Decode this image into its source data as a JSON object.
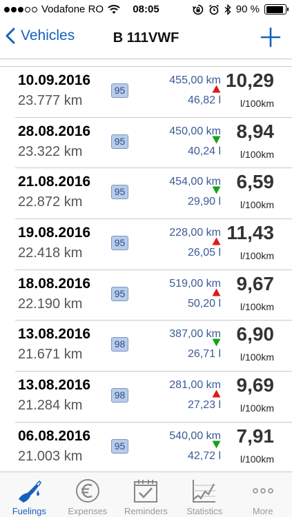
{
  "status_bar": {
    "carrier": "Vodafone RO",
    "time": "08:05",
    "battery": "90 %",
    "battery_level": 0.9,
    "signal_bars": 3
  },
  "nav": {
    "back_label": "Vehicles",
    "title": "B 111VWF"
  },
  "entries": [
    {
      "date": "10.09.2016",
      "odometer": "23.777 km",
      "fuel": "95",
      "distance": "455,00 km",
      "volume": "46,82 l",
      "trend": "up",
      "consumption": "10,29",
      "unit": "l/100km"
    },
    {
      "date": "28.08.2016",
      "odometer": "23.322 km",
      "fuel": "95",
      "distance": "450,00 km",
      "volume": "40,24 l",
      "trend": "down",
      "consumption": "8,94",
      "unit": "l/100km"
    },
    {
      "date": "21.08.2016",
      "odometer": "22.872 km",
      "fuel": "95",
      "distance": "454,00 km",
      "volume": "29,90 l",
      "trend": "down",
      "consumption": "6,59",
      "unit": "l/100km"
    },
    {
      "date": "19.08.2016",
      "odometer": "22.418 km",
      "fuel": "95",
      "distance": "228,00 km",
      "volume": "26,05 l",
      "trend": "up",
      "consumption": "11,43",
      "unit": "l/100km"
    },
    {
      "date": "18.08.2016",
      "odometer": "22.190 km",
      "fuel": "95",
      "distance": "519,00 km",
      "volume": "50,20 l",
      "trend": "up",
      "consumption": "9,67",
      "unit": "l/100km"
    },
    {
      "date": "13.08.2016",
      "odometer": "21.671 km",
      "fuel": "98",
      "distance": "387,00 km",
      "volume": "26,71 l",
      "trend": "down",
      "consumption": "6,90",
      "unit": "l/100km"
    },
    {
      "date": "13.08.2016",
      "odometer": "21.284 km",
      "fuel": "98",
      "distance": "281,00 km",
      "volume": "27,23 l",
      "trend": "up",
      "consumption": "9,69",
      "unit": "l/100km"
    },
    {
      "date": "06.08.2016",
      "odometer": "21.003 km",
      "fuel": "95",
      "distance": "540,00 km",
      "volume": "42,72 l",
      "trend": "down",
      "consumption": "7,91",
      "unit": "l/100km"
    }
  ],
  "tabs": [
    {
      "label": "Fuelings",
      "icon": "fuel-pump-icon",
      "active": true
    },
    {
      "label": "Expenses",
      "icon": "euro-icon",
      "active": false
    },
    {
      "label": "Reminders",
      "icon": "calendar-icon",
      "active": false
    },
    {
      "label": "Statistics",
      "icon": "chart-icon",
      "active": false
    },
    {
      "label": "More",
      "icon": "more-dots-icon",
      "active": false
    }
  ],
  "colors": {
    "accent": "#1560bd",
    "trend_up": "#e0191d",
    "trend_down": "#17a21b",
    "badge_bg": "#b9cce8"
  }
}
